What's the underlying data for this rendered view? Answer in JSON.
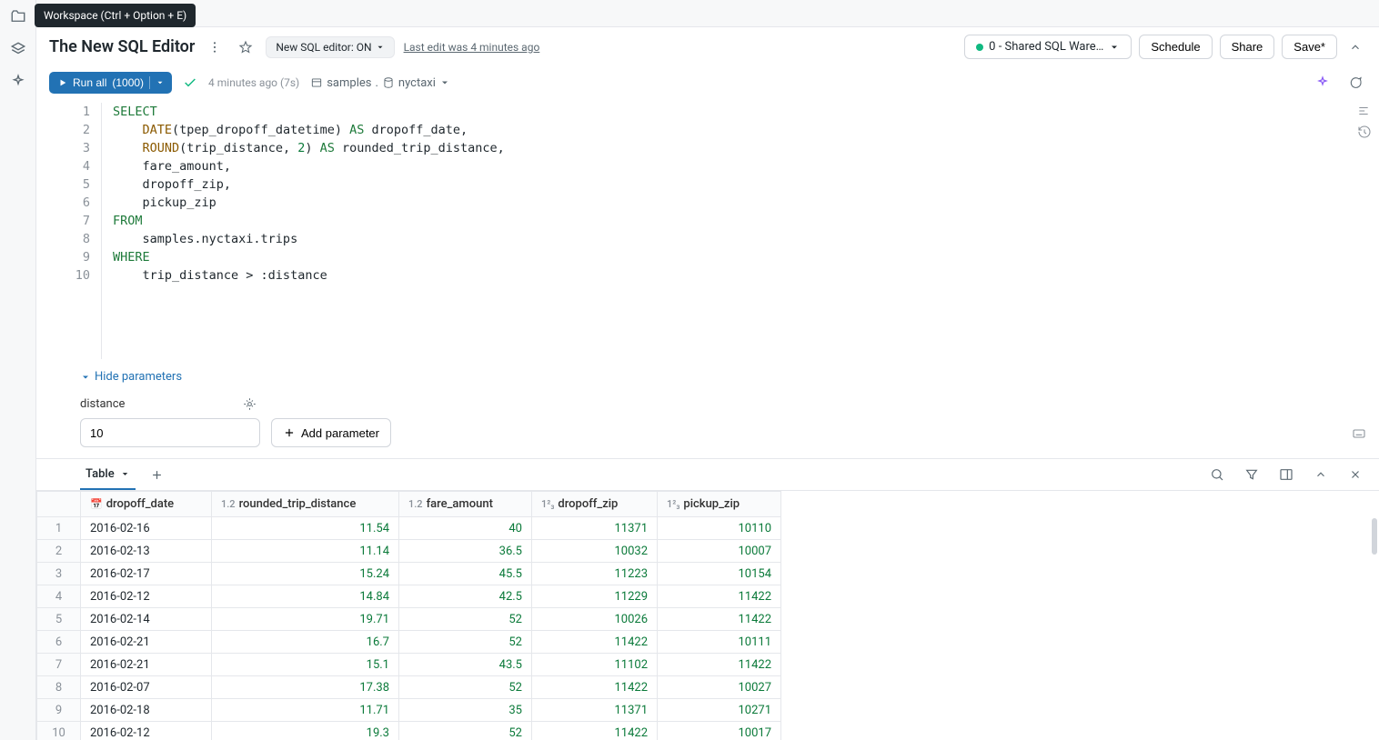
{
  "tooltip": "Workspace (Ctrl + Option + E)",
  "header": {
    "title": "The New SQL Editor",
    "editor_toggle": "New SQL editor: ON",
    "last_edit": "Last edit was 4 minutes ago",
    "warehouse": "0 - Shared SQL Ware…",
    "schedule": "Schedule",
    "share": "Share",
    "save": "Save*"
  },
  "toolbar": {
    "run_label": "Run all",
    "run_count": "(1000)",
    "status_time": "4 minutes ago (7s)",
    "catalog": "samples",
    "schema": "nyctaxi"
  },
  "code": {
    "lines": [
      [
        {
          "t": "SELECT",
          "c": "kw"
        }
      ],
      [
        {
          "t": "    "
        },
        {
          "t": "DATE",
          "c": "fn"
        },
        {
          "t": "(tpep_dropoff_datetime) "
        },
        {
          "t": "AS",
          "c": "kw"
        },
        {
          "t": " dropoff_date,"
        }
      ],
      [
        {
          "t": "    "
        },
        {
          "t": "ROUND",
          "c": "fn"
        },
        {
          "t": "(trip_distance, "
        },
        {
          "t": "2",
          "c": "num"
        },
        {
          "t": ") "
        },
        {
          "t": "AS",
          "c": "kw"
        },
        {
          "t": " rounded_trip_distance,"
        }
      ],
      [
        {
          "t": "    fare_amount,"
        }
      ],
      [
        {
          "t": "    dropoff_zip,"
        }
      ],
      [
        {
          "t": "    pickup_zip"
        }
      ],
      [
        {
          "t": "FROM",
          "c": "kw"
        }
      ],
      [
        {
          "t": "    samples.nyctaxi.trips"
        }
      ],
      [
        {
          "t": "WHERE",
          "c": "kw"
        }
      ],
      [
        {
          "t": "    trip_distance > :distance"
        }
      ]
    ]
  },
  "params": {
    "toggle": "Hide parameters",
    "distance_label": "distance",
    "distance_value": "10",
    "add": "Add parameter"
  },
  "results": {
    "tab": "Table",
    "columns": [
      "dropoff_date",
      "rounded_trip_distance",
      "fare_amount",
      "dropoff_zip",
      "pickup_zip"
    ],
    "col_types": [
      "date",
      "num",
      "num",
      "int",
      "int"
    ],
    "rows": [
      [
        "2016-02-16",
        "11.54",
        "40",
        "11371",
        "10110"
      ],
      [
        "2016-02-13",
        "11.14",
        "36.5",
        "10032",
        "10007"
      ],
      [
        "2016-02-17",
        "15.24",
        "45.5",
        "11223",
        "10154"
      ],
      [
        "2016-02-12",
        "14.84",
        "42.5",
        "11229",
        "11422"
      ],
      [
        "2016-02-14",
        "19.71",
        "52",
        "10026",
        "11422"
      ],
      [
        "2016-02-21",
        "16.7",
        "52",
        "11422",
        "10111"
      ],
      [
        "2016-02-21",
        "15.1",
        "43.5",
        "11102",
        "11422"
      ],
      [
        "2016-02-07",
        "17.38",
        "52",
        "11422",
        "10027"
      ],
      [
        "2016-02-18",
        "11.71",
        "35",
        "11371",
        "10271"
      ],
      [
        "2016-02-12",
        "19.3",
        "52",
        "11422",
        "10017"
      ]
    ]
  }
}
